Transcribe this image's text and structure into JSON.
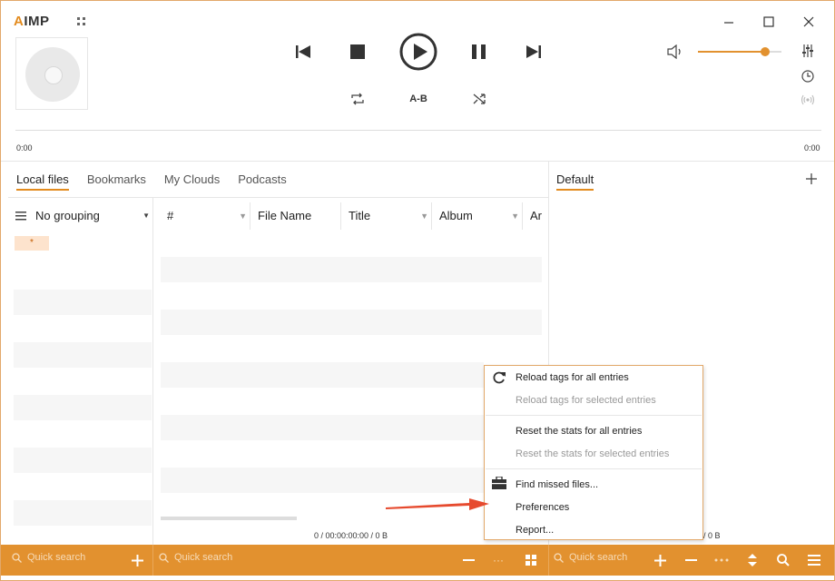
{
  "app": {
    "logo_prefix": "A",
    "logo_rest": "IMP"
  },
  "player": {
    "time_left": "0:00",
    "time_right": "0:00",
    "ab_label": "A-B",
    "volume_level": 0.8
  },
  "tabs": [
    "Local files",
    "Bookmarks",
    "My Clouds",
    "Podcasts"
  ],
  "playlist_tab": "Default",
  "grouping": {
    "label": "No grouping"
  },
  "group_chip": "*",
  "columns": [
    {
      "label": "#"
    },
    {
      "label": "File Name"
    },
    {
      "label": "Title"
    },
    {
      "label": "Album"
    },
    {
      "label": "Ar"
    }
  ],
  "status": {
    "middle": "0 / 00:00:00:00 / 0 B",
    "right": "/ 0 B"
  },
  "bottom_bar": {
    "search_placeholder_1": "Quick search",
    "search_placeholder_2": "Quick search",
    "search_placeholder_3": "Quick search",
    "more_label": "···"
  },
  "context_menu": {
    "items": [
      {
        "label": "Reload tags for all entries",
        "enabled": true,
        "icon": "refresh-icon"
      },
      {
        "label": "Reload tags for selected entries",
        "enabled": false
      },
      {
        "label": "Reset the stats for all entries",
        "enabled": true
      },
      {
        "label": "Reset the stats for selected entries",
        "enabled": false
      },
      {
        "label": "Find missed files...",
        "enabled": true,
        "icon": "toolbox-icon"
      },
      {
        "label": "Preferences",
        "enabled": true
      },
      {
        "label": "Report...",
        "enabled": true
      }
    ]
  },
  "colors": {
    "accent": "#e2912f",
    "accent_dark": "#e38b1e",
    "annotation_arrow": "#e64a2e"
  }
}
